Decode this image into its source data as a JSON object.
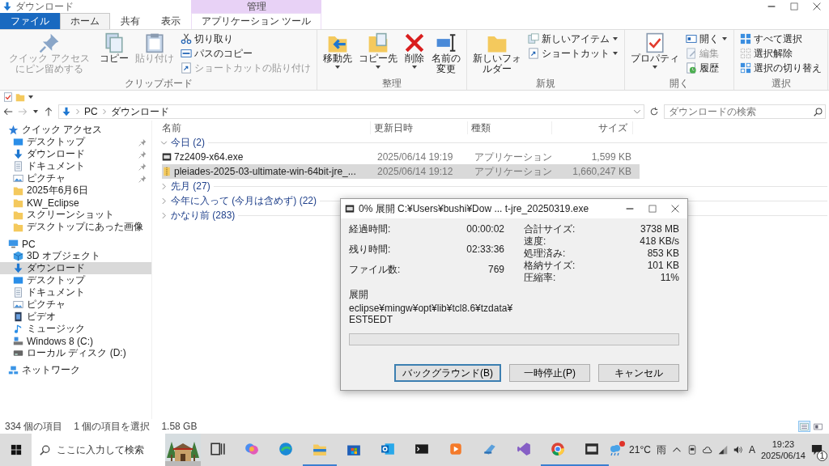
{
  "window": {
    "title": "ダウンロード"
  },
  "ribbon": {
    "context_label": "管理",
    "tabs": [
      {
        "label": "ファイル",
        "kind": "file",
        "selected": false
      },
      {
        "label": "ホーム",
        "kind": "tab",
        "selected": true
      },
      {
        "label": "共有",
        "kind": "tab",
        "selected": false
      },
      {
        "label": "表示",
        "kind": "tab",
        "selected": false
      },
      {
        "label": "アプリケーション ツール",
        "kind": "context",
        "selected": false
      }
    ],
    "groups": [
      {
        "label": "クリップボード",
        "items": [
          {
            "label": "クイック アクセスにピン留めする",
            "kind": "pin",
            "disabled": true,
            "dropdown": false
          },
          {
            "label": "コピー",
            "kind": "copy",
            "disabled": false,
            "dropdown": false
          },
          {
            "label": "貼り付け",
            "kind": "paste",
            "disabled": true,
            "dropdown": false
          },
          {
            "label": "切り取り",
            "kind": "cut",
            "disabled": false,
            "dropdown": false
          },
          {
            "label": "パスのコピー",
            "kind": "copypath",
            "disabled": false,
            "dropdown": false
          },
          {
            "label": "ショートカットの貼り付け",
            "kind": "pasteshortcut",
            "disabled": true,
            "dropdown": false
          }
        ]
      },
      {
        "label": "整理",
        "items": [
          {
            "label": "移動先",
            "kind": "moveto",
            "disabled": false,
            "dropdown": true
          },
          {
            "label": "コピー先",
            "kind": "copyto",
            "disabled": false,
            "dropdown": true
          },
          {
            "label": "削除",
            "kind": "delete",
            "disabled": false,
            "dropdown": true
          },
          {
            "label": "名前の変更",
            "kind": "rename",
            "disabled": false,
            "dropdown": false
          }
        ]
      },
      {
        "label": "新規",
        "items": [
          {
            "label": "新しいフォルダー",
            "kind": "newfolder",
            "disabled": false,
            "dropdown": false
          },
          {
            "label": "新しいアイテム",
            "kind": "newitem",
            "disabled": false,
            "dropdown": true
          },
          {
            "label": "ショートカット",
            "kind": "shortcut",
            "disabled": false,
            "dropdown": true
          }
        ]
      },
      {
        "label": "開く",
        "items": [
          {
            "label": "プロパティ",
            "kind": "properties",
            "disabled": false,
            "dropdown": true
          },
          {
            "label": "開く",
            "kind": "open",
            "disabled": false,
            "dropdown": true
          },
          {
            "label": "編集",
            "kind": "edit",
            "disabled": true,
            "dropdown": false
          },
          {
            "label": "履歴",
            "kind": "history",
            "disabled": false,
            "dropdown": false
          }
        ]
      },
      {
        "label": "選択",
        "items": [
          {
            "label": "すべて選択",
            "kind": "selectall",
            "disabled": false,
            "dropdown": false
          },
          {
            "label": "選択解除",
            "kind": "selectnone",
            "disabled": false,
            "dropdown": false
          },
          {
            "label": "選択の切り替え",
            "kind": "invert",
            "disabled": false,
            "dropdown": false
          }
        ]
      }
    ]
  },
  "address": {
    "path": [
      "PC",
      "ダウンロード"
    ],
    "search_placeholder": "ダウンロードの検索"
  },
  "sidebar": {
    "items": [
      {
        "label": "クイック アクセス",
        "kind": "star",
        "pinned": false,
        "selected": false,
        "children": [
          {
            "label": "デスクトップ",
            "kind": "desktop",
            "pinned": true,
            "selected": false
          },
          {
            "label": "ダウンロード",
            "kind": "download",
            "pinned": true,
            "selected": false
          },
          {
            "label": "ドキュメント",
            "kind": "document",
            "pinned": true,
            "selected": false
          },
          {
            "label": "ピクチャ",
            "kind": "picture",
            "pinned": true,
            "selected": false
          },
          {
            "label": "2025年6月6日",
            "kind": "folder",
            "pinned": false,
            "selected": false
          },
          {
            "label": "KW_Eclipse",
            "kind": "folder",
            "pinned": false,
            "selected": false
          },
          {
            "label": "スクリーンショット",
            "kind": "folder",
            "pinned": false,
            "selected": false
          },
          {
            "label": "デスクトップにあった画像",
            "kind": "folder",
            "pinned": false,
            "selected": false
          }
        ]
      },
      {
        "label": "PC",
        "kind": "pc",
        "pinned": false,
        "selected": false,
        "children": [
          {
            "label": "3D オブジェクト",
            "kind": "cube",
            "pinned": false,
            "selected": false
          },
          {
            "label": "ダウンロード",
            "kind": "download",
            "pinned": false,
            "selected": true
          },
          {
            "label": "デスクトップ",
            "kind": "desktop",
            "pinned": false,
            "selected": false
          },
          {
            "label": "ドキュメント",
            "kind": "document",
            "pinned": false,
            "selected": false
          },
          {
            "label": "ピクチャ",
            "kind": "picture",
            "pinned": false,
            "selected": false
          },
          {
            "label": "ビデオ",
            "kind": "video",
            "pinned": false,
            "selected": false
          },
          {
            "label": "ミュージック",
            "kind": "music",
            "pinned": false,
            "selected": false
          },
          {
            "label": "Windows 8 (C:)",
            "kind": "sysdrive",
            "pinned": false,
            "selected": false
          },
          {
            "label": "ローカル ディスク (D:)",
            "kind": "drive",
            "pinned": false,
            "selected": false
          }
        ]
      },
      {
        "label": "ネットワーク",
        "kind": "network",
        "pinned": false,
        "selected": false
      }
    ]
  },
  "file_list": {
    "columns": [
      "名前",
      "更新日時",
      "種類",
      "サイズ"
    ],
    "groups": [
      {
        "label": "今日 (2)",
        "expanded": true,
        "rows": [
          {
            "name": "7z2409-x64.exe",
            "modified": "2025/06/14 19:19",
            "type": "アプリケーション",
            "size": "1,599 KB",
            "kind": "app",
            "selected": false
          },
          {
            "name": "pleiades-2025-03-ultimate-win-64bit-jre_...",
            "modified": "2025/06/14 19:12",
            "type": "アプリケーション",
            "size": "1,660,247 KB",
            "kind": "archive",
            "selected": true
          }
        ]
      },
      {
        "label": "先月 (27)",
        "expanded": false
      },
      {
        "label": "今年に入って (今月は含めず) (22)",
        "expanded": false
      },
      {
        "label": "かなり前 (283)",
        "expanded": false
      }
    ]
  },
  "dialog": {
    "title": "0% 展開 C:¥Users¥bushi¥Dow ... t-jre_20250319.exe",
    "stats_left": [
      {
        "label": "経過時間:",
        "value": "00:00:02"
      },
      {
        "label": "残り時間:",
        "value": "02:33:36"
      },
      {
        "label": "ファイル数:",
        "value": "769"
      }
    ],
    "stats_right": [
      {
        "label": "合計サイズ:",
        "value": "3738 MB"
      },
      {
        "label": "速度:",
        "value": "418 KB/s"
      },
      {
        "label": "処理済み:",
        "value": "853 KB"
      },
      {
        "label": "格納サイズ:",
        "value": "101 KB"
      },
      {
        "label": "圧縮率:",
        "value": "11%"
      }
    ],
    "section_label": "展開",
    "current_file": [
      "eclipse¥mingw¥opt¥lib¥tcl8.6¥tzdata¥",
      "EST5EDT"
    ],
    "level": 0,
    "buttons": [
      {
        "label": "バックグラウンド(B)",
        "default": true
      },
      {
        "label": "一時停止(P)",
        "default": false
      },
      {
        "label": "キャンセル",
        "default": false
      }
    ]
  },
  "status_bar": {
    "item_count": "334 個の項目",
    "selection": "1 個の項目を選択",
    "selection_size": "1.58 GB",
    "views": [
      {
        "kind": "details",
        "selected": true
      },
      {
        "kind": "tiles",
        "selected": false
      }
    ]
  },
  "taskbar": {
    "search_placeholder": "ここに入力して検索",
    "apps": [
      {
        "kind": "taskview",
        "active": false
      },
      {
        "kind": "copilot",
        "active": false
      },
      {
        "kind": "edge",
        "active": false
      },
      {
        "kind": "explorer",
        "active": true
      },
      {
        "kind": "store",
        "active": false
      },
      {
        "kind": "outlook",
        "active": false
      },
      {
        "kind": "terminal",
        "active": false
      },
      {
        "kind": "media",
        "active": false
      },
      {
        "kind": "tool",
        "active": false
      },
      {
        "kind": "vs",
        "active": false
      },
      {
        "kind": "chrome",
        "active": true
      },
      {
        "kind": "sevenzip",
        "active": true
      }
    ],
    "weather": {
      "temperature": "21°C",
      "condition": "雨",
      "alert": true
    },
    "ime": "A",
    "time": "19:23",
    "date": "2025/06/14",
    "notifications": "1"
  }
}
